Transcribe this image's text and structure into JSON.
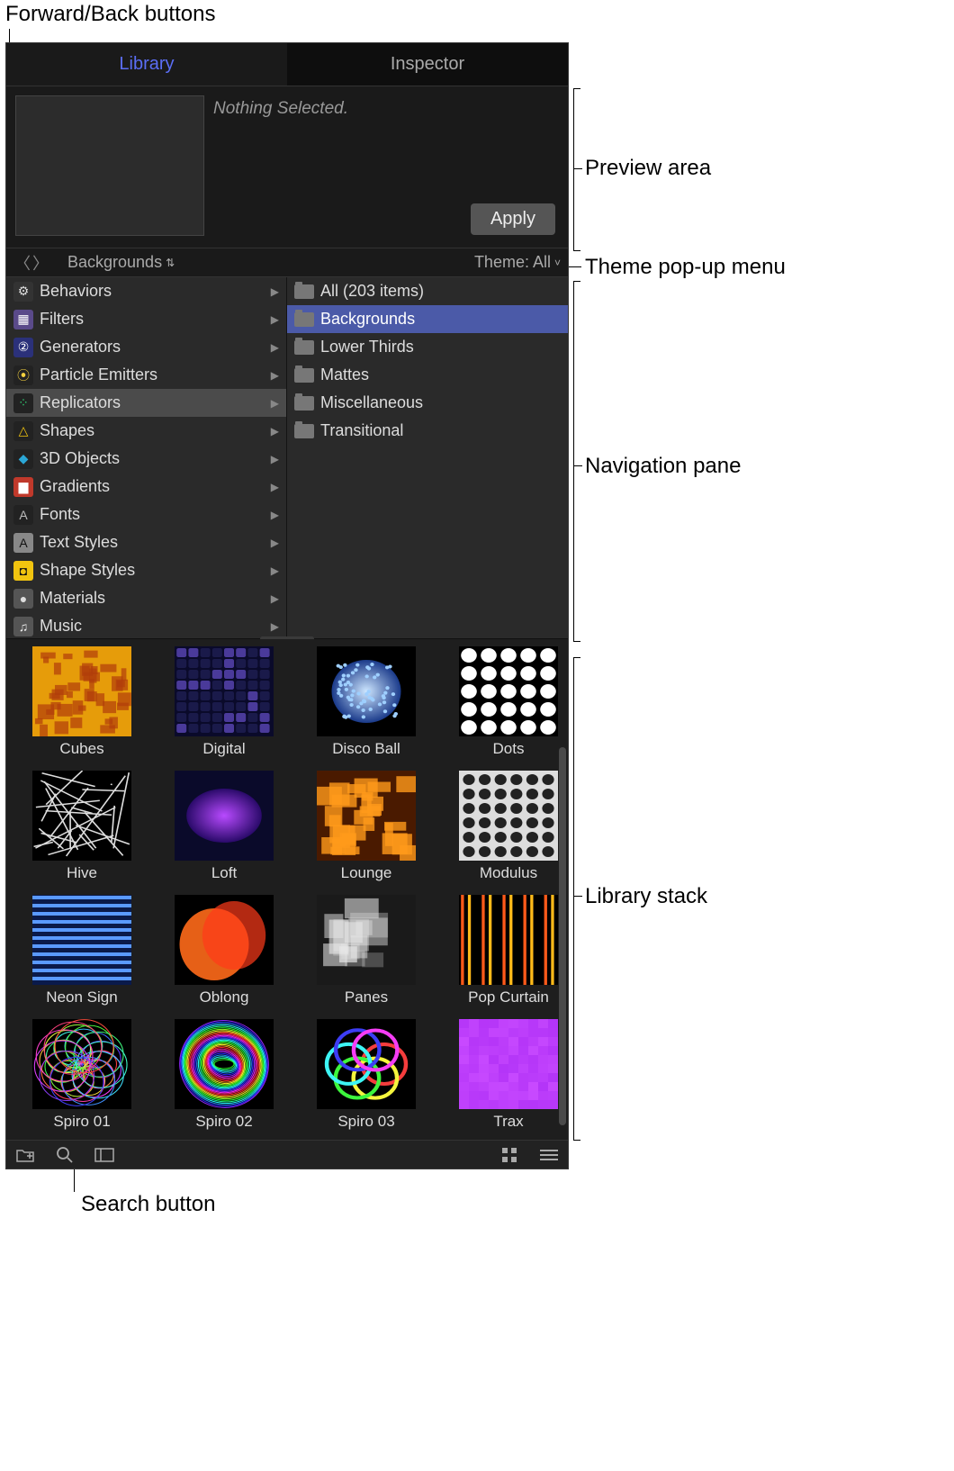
{
  "callouts": {
    "fwdback": "Forward/Back buttons",
    "preview": "Preview area",
    "theme": "Theme pop-up menu",
    "nav": "Navigation pane",
    "stack": "Library stack",
    "search": "Search button"
  },
  "tabs": {
    "library": "Library",
    "inspector": "Inspector"
  },
  "preview": {
    "status": "Nothing Selected.",
    "apply": "Apply"
  },
  "pathbar": {
    "location": "Backgrounds",
    "theme_label": "Theme: All"
  },
  "categories": [
    {
      "label": "Behaviors",
      "icon_bg": "#333",
      "icon_fg": "#ddd",
      "glyph": "⚙"
    },
    {
      "label": "Filters",
      "icon_bg": "#5a4a8a",
      "icon_fg": "#fff",
      "glyph": "▦"
    },
    {
      "label": "Generators",
      "icon_bg": "#2b317a",
      "icon_fg": "#fff",
      "glyph": "②"
    },
    {
      "label": "Particle Emitters",
      "icon_bg": "#222",
      "icon_fg": "#f4d03f",
      "glyph": "⦿"
    },
    {
      "label": "Replicators",
      "icon_bg": "#222",
      "icon_fg": "#2ecc71",
      "glyph": "⁘",
      "selected": true
    },
    {
      "label": "Shapes",
      "icon_bg": "#222",
      "icon_fg": "#f1c40f",
      "glyph": "△"
    },
    {
      "label": "3D Objects",
      "icon_bg": "#222",
      "icon_fg": "#2ba7d6",
      "glyph": "◆"
    },
    {
      "label": "Gradients",
      "icon_bg": "#c0392b",
      "icon_fg": "#fff",
      "glyph": "▆"
    },
    {
      "label": "Fonts",
      "icon_bg": "#222",
      "icon_fg": "#bbb",
      "glyph": "A"
    },
    {
      "label": "Text Styles",
      "icon_bg": "#888",
      "icon_fg": "#111",
      "glyph": "A"
    },
    {
      "label": "Shape Styles",
      "icon_bg": "#f1c40f",
      "icon_fg": "#111",
      "glyph": "◘"
    },
    {
      "label": "Materials",
      "icon_bg": "#555",
      "icon_fg": "#ddd",
      "glyph": "●"
    },
    {
      "label": "Music",
      "icon_bg": "#555",
      "icon_fg": "#eee",
      "glyph": "♫"
    }
  ],
  "subfolders": [
    {
      "label": "All (203 items)"
    },
    {
      "label": "Backgrounds",
      "selected": true
    },
    {
      "label": "Lower Thirds"
    },
    {
      "label": "Mattes"
    },
    {
      "label": "Miscellaneous"
    },
    {
      "label": "Transitional"
    }
  ],
  "items": [
    {
      "label": "Cubes"
    },
    {
      "label": "Digital"
    },
    {
      "label": "Disco Ball"
    },
    {
      "label": "Dots"
    },
    {
      "label": "Hive"
    },
    {
      "label": "Loft"
    },
    {
      "label": "Lounge"
    },
    {
      "label": "Modulus"
    },
    {
      "label": "Neon Sign"
    },
    {
      "label": "Oblong"
    },
    {
      "label": "Panes"
    },
    {
      "label": "Pop Curtain"
    },
    {
      "label": "Spiro 01"
    },
    {
      "label": "Spiro 02"
    },
    {
      "label": "Spiro 03"
    },
    {
      "label": "Trax"
    }
  ]
}
